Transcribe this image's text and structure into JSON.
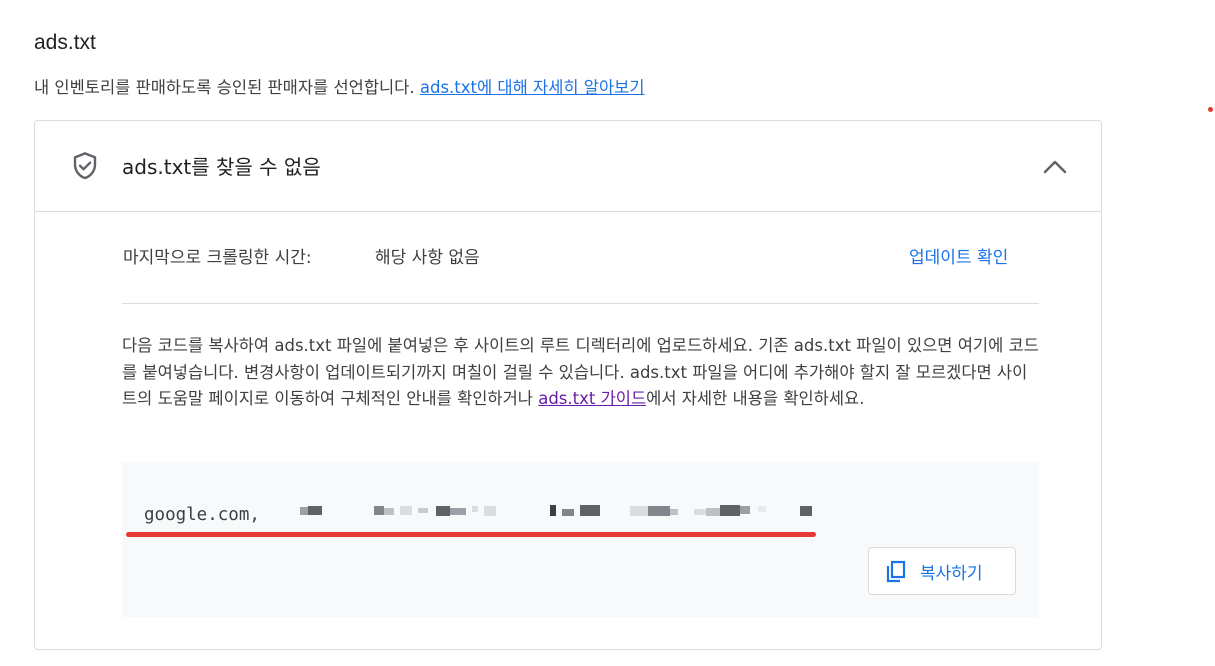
{
  "header": {
    "title": "ads.txt",
    "description": "내 인벤토리를 판매하도록 승인된 판매자를 선언합니다.",
    "learn_more": "ads.txt에 대해 자세히 알아보기"
  },
  "card": {
    "status_icon": "shield-check-icon",
    "status_text": "ads.txt를 찾을 수 없음",
    "collapse_icon": "chevron-up-icon",
    "crawl_label": "마지막으로 크롤링한 시간:",
    "crawl_value": "해당 사항 없음",
    "check_update": "업데이트 확인",
    "instructions_text": "다음 코드를 복사하여 ads.txt 파일에 붙여넣은 후 사이트의 루트 디렉터리에 업로드하세요. 기존 ads.txt 파일이 있으면 여기에 코드를 붙여넣습니다. 변경사항이 업데이트되기까지 며칠이 걸릴 수 있습니다. ads.txt 파일을 어디에 추가해야 할지 잘 모르겠다면 사이트의 도움말 페이지로 이동하여 구체적인 안내를 확인하거나 ",
    "guide_link": "ads.txt 가이드",
    "instructions_suffix": "에서 자세한 내용을 확인하세요.",
    "code_text": "google.com,",
    "copy_icon": "copy-icon",
    "copy_label": "복사하기"
  },
  "colors": {
    "link": "#1a73e8",
    "visited_link": "#681da8",
    "annotation": "#e53935",
    "border": "#dadce0"
  }
}
